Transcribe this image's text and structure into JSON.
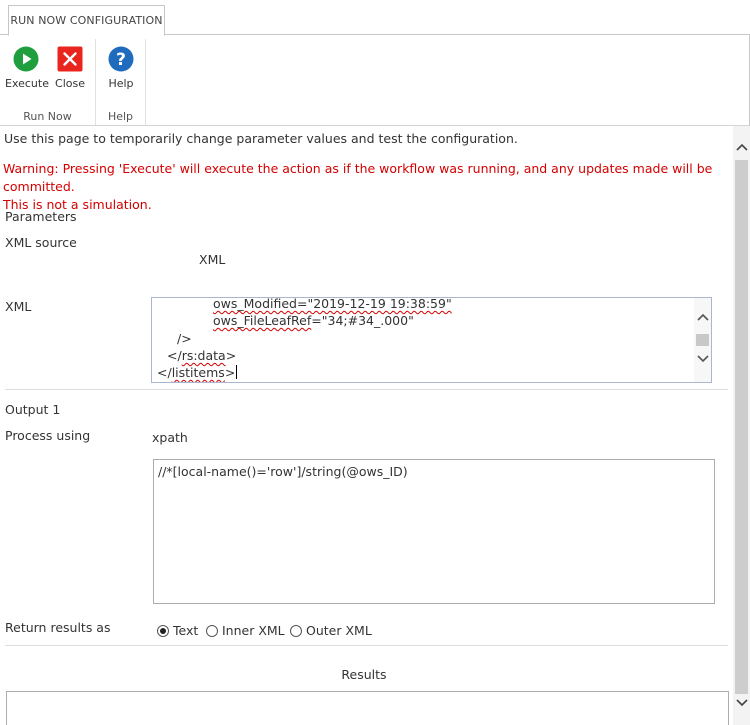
{
  "tab": {
    "label": "RUN NOW CONFIGURATION"
  },
  "ribbon": {
    "groups": [
      {
        "label": "Run Now",
        "buttons": [
          {
            "label": "Execute"
          },
          {
            "label": "Close"
          }
        ]
      },
      {
        "label": "Help",
        "buttons": [
          {
            "label": "Help"
          }
        ]
      }
    ],
    "colors": {
      "execute": "#1e9e3c",
      "close": "#e8261e",
      "help": "#1f6bbd"
    }
  },
  "intro": "Use this page to temporarily change parameter values and test the configuration.",
  "warning": {
    "line1": "Warning: Pressing 'Execute' will execute the action as if the workflow was running, and any updates made will be committed.",
    "line2": "This is not a simulation.",
    "color": "#d40000"
  },
  "parameters": {
    "heading": "Parameters",
    "xml_source_label": "XML source",
    "xml_source_value": "XML",
    "xml_label": "XML",
    "xml_lines": {
      "l1_pre": "ows_Modified=\"2019-12-19 19:38:59\"",
      "l2_squig": "ows_FileLeafRef",
      "l2_rest": "=\"34;#34_.000\"",
      "l3": "/>",
      "l4_open": "</",
      "l4_squig": "rs:data",
      "l4_close": ">",
      "l5_open": "</",
      "l5_squig": "listitems",
      "l5_close": ">"
    }
  },
  "output": {
    "heading": "Output 1",
    "process_label": "Process using",
    "process_value": "xpath",
    "xpath_expression": "//*[local-name()='row']/string(@ows_ID)",
    "return_label": "Return results as",
    "options": [
      "Text",
      "Inner XML",
      "Outer XML"
    ],
    "selected": "Text"
  },
  "results": {
    "heading": "Results"
  }
}
